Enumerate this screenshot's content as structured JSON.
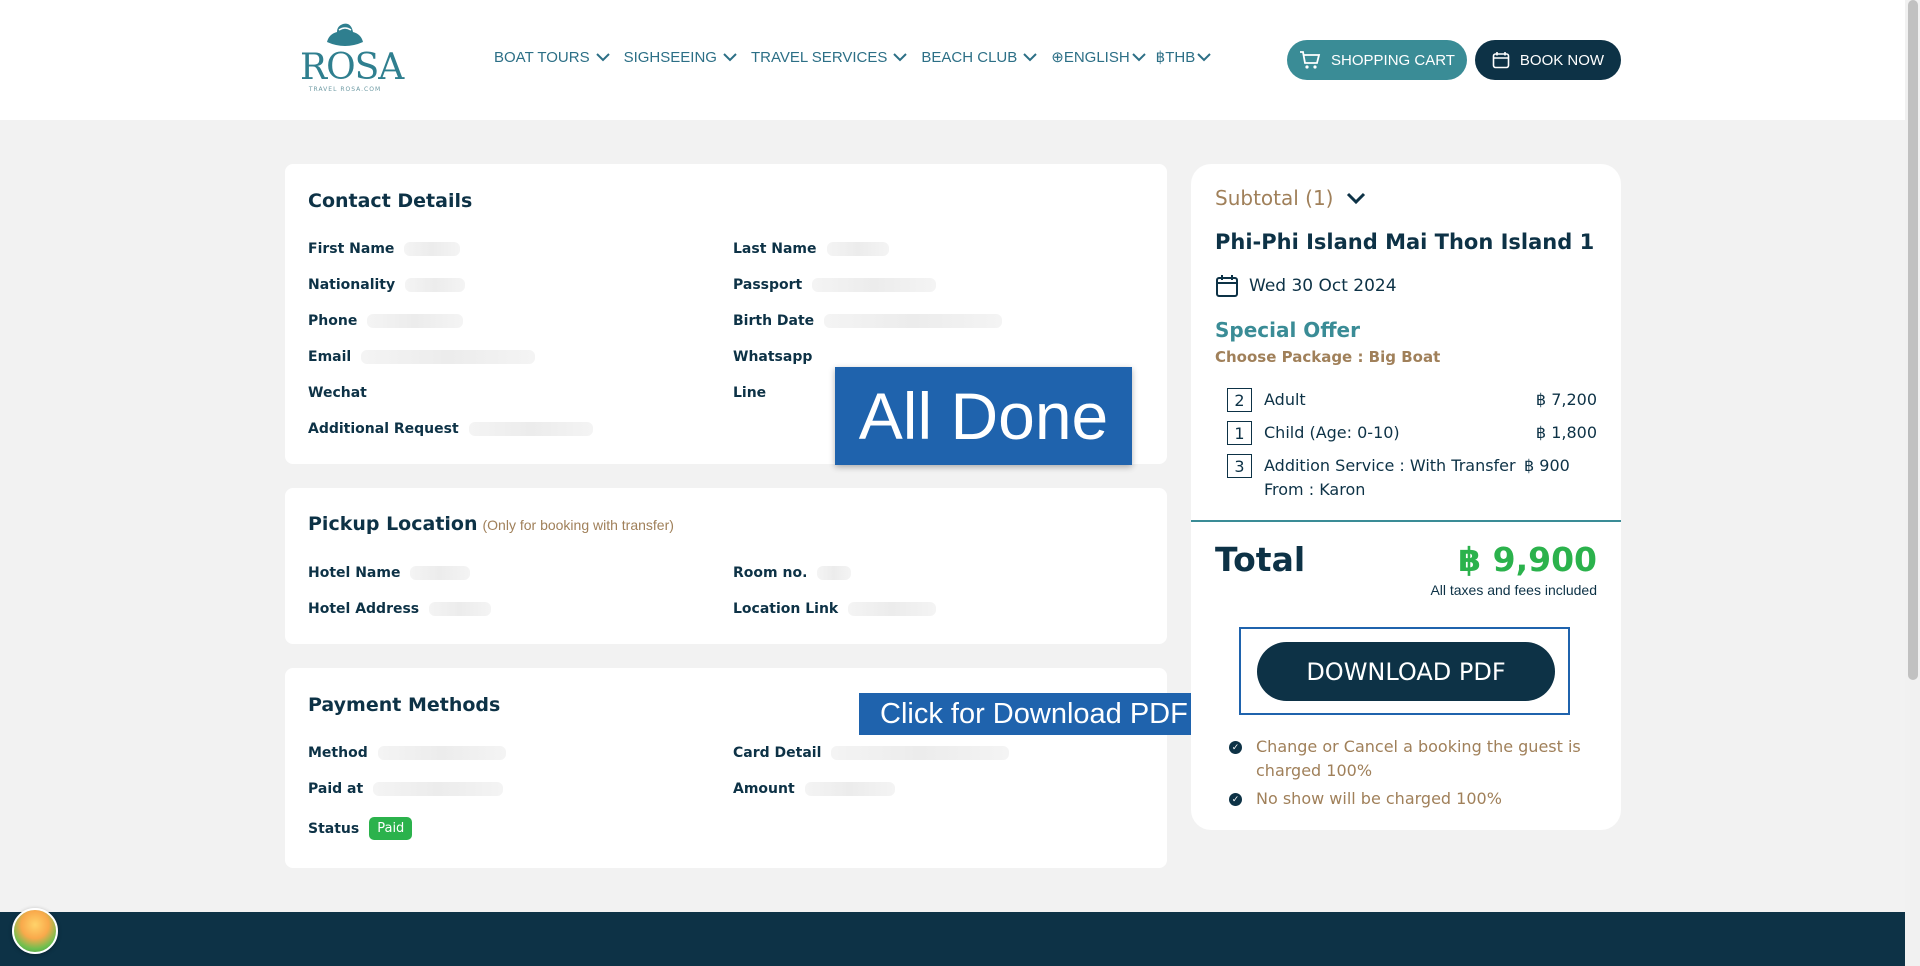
{
  "brand": {
    "name": "ROSA",
    "tagline": "TRAVEL ROSA.COM"
  },
  "nav": {
    "items": [
      {
        "label": "BOAT TOURS"
      },
      {
        "label": "SIGHSEEING"
      },
      {
        "label": "TRAVEL SERVICES"
      },
      {
        "label": "BEACH CLUB"
      },
      {
        "label": "⊕ENGLISH"
      },
      {
        "label": "฿THB"
      }
    ],
    "cart_label": "SHOPPING CART",
    "book_label": "BOOK NOW"
  },
  "contact": {
    "title": "Contact Details",
    "fields": {
      "first_name": "First Name",
      "last_name": "Last Name",
      "nationality": "Nationality",
      "passport": "Passport",
      "phone": "Phone",
      "birth_date": "Birth Date",
      "email": "Email",
      "whatsapp": "Whatsapp",
      "wechat": "Wechat",
      "line": "Line",
      "additional": "Additional Request"
    }
  },
  "pickup": {
    "title": "Pickup Location",
    "note": "(Only for booking with transfer)",
    "fields": {
      "hotel_name": "Hotel Name",
      "room_no": "Room no.",
      "hotel_address": "Hotel Address",
      "location_link": "Location Link"
    }
  },
  "payment": {
    "title": "Payment Methods",
    "fields": {
      "method": "Method",
      "card_detail": "Card Detail",
      "paid_at": "Paid at",
      "amount": "Amount",
      "status": "Status"
    },
    "status_value": "Paid"
  },
  "overlays": {
    "all_done": "All Done",
    "download_tip": "Click for Download PDF file"
  },
  "summary": {
    "subtotal": "Subtotal (1)",
    "tour_title": "Phi-Phi Island Mai Thon Island 1",
    "date": "Wed 30 Oct 2024",
    "offer": "Special Offer",
    "package": "Choose Package : Big Boat",
    "items": [
      {
        "qty": "2",
        "desc": "Adult",
        "price": "฿ 7,200"
      },
      {
        "qty": "1",
        "desc": "Child (Age: 0-10)",
        "price": "฿ 1,800"
      },
      {
        "qty": "3",
        "desc": "Addition Service : With Transfer From : Karon",
        "price": "฿ 900"
      }
    ],
    "total_label": "Total",
    "total_value": "฿ 9,900",
    "tax_note": "All taxes and fees included",
    "download_label": "DOWNLOAD PDF",
    "policies": [
      "Change or Cancel a booking the guest is charged 100%",
      "No show will be charged 100%"
    ]
  }
}
